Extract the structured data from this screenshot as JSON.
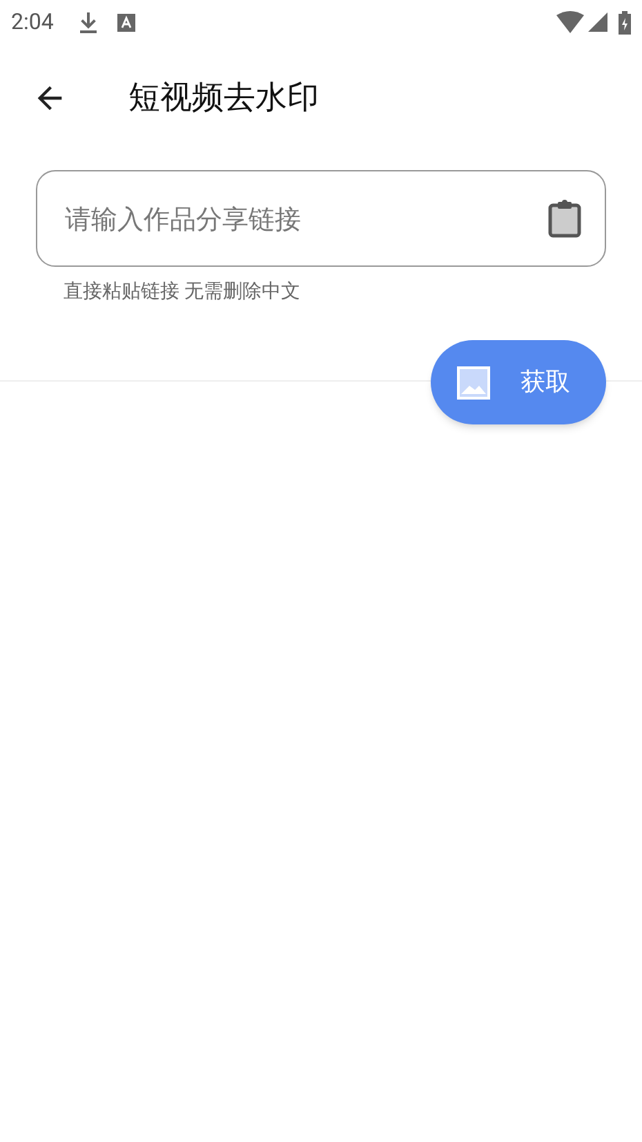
{
  "status_bar": {
    "time": "2:04"
  },
  "toolbar": {
    "title": "短视频去水印"
  },
  "link_field": {
    "placeholder": "请输入作品分享链接",
    "helper": "直接粘贴链接 无需删除中文"
  },
  "fetch_button": {
    "label": "获取"
  }
}
